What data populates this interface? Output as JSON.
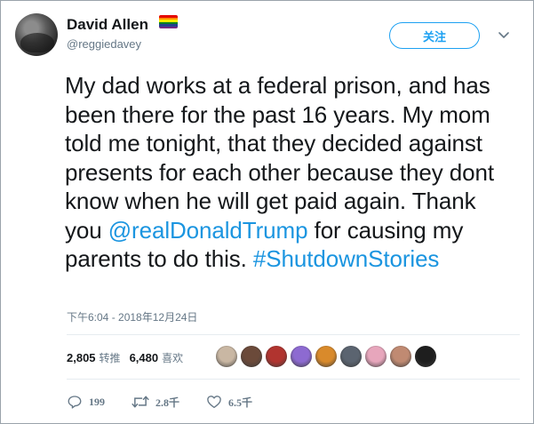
{
  "author": {
    "name": "David Allen",
    "handle": "@reggiedavey",
    "flag_colors": [
      "#e40303",
      "#ff8c00",
      "#ffed00",
      "#008026",
      "#24408e",
      "#732982"
    ]
  },
  "follow_button": {
    "label": "关注"
  },
  "tweet": {
    "text_before": "My dad works at a federal prison, and has been there for the past 16 years. My mom told me tonight, that they decided against presents for each other because they dont know when he will get paid again. Thank you ",
    "mention": "@realDonaldTrump",
    "text_after": " for causing my parents to do this. ",
    "hashtag": "#ShutdownStories",
    "timestamp": "下午6:04 - 2018年12月24日"
  },
  "stats": {
    "retweets_count": "2,805",
    "retweets_label": "转推",
    "likes_count": "6,480",
    "likes_label": "喜欢"
  },
  "likers": [
    {
      "icon": "liker-avatar",
      "color": "#c9b7a3"
    },
    {
      "icon": "liker-avatar",
      "color": "#6b4a3a"
    },
    {
      "icon": "liker-avatar",
      "color": "#b1342f"
    },
    {
      "icon": "liker-avatar",
      "color": "#8d6ad1"
    },
    {
      "icon": "liker-avatar",
      "color": "#d98a2b"
    },
    {
      "icon": "liker-avatar",
      "color": "#5b6470"
    },
    {
      "icon": "liker-avatar",
      "color": "#e7a6bc"
    },
    {
      "icon": "liker-avatar",
      "color": "#c08a72"
    },
    {
      "icon": "liker-avatar",
      "color": "#1e1e1e"
    }
  ],
  "actions": {
    "reply_count": "199",
    "retweet_count": "2.8千",
    "like_count": "6.5千"
  },
  "colors": {
    "accent": "#1da1f2",
    "link": "#1b95e0",
    "muted": "#657786"
  }
}
